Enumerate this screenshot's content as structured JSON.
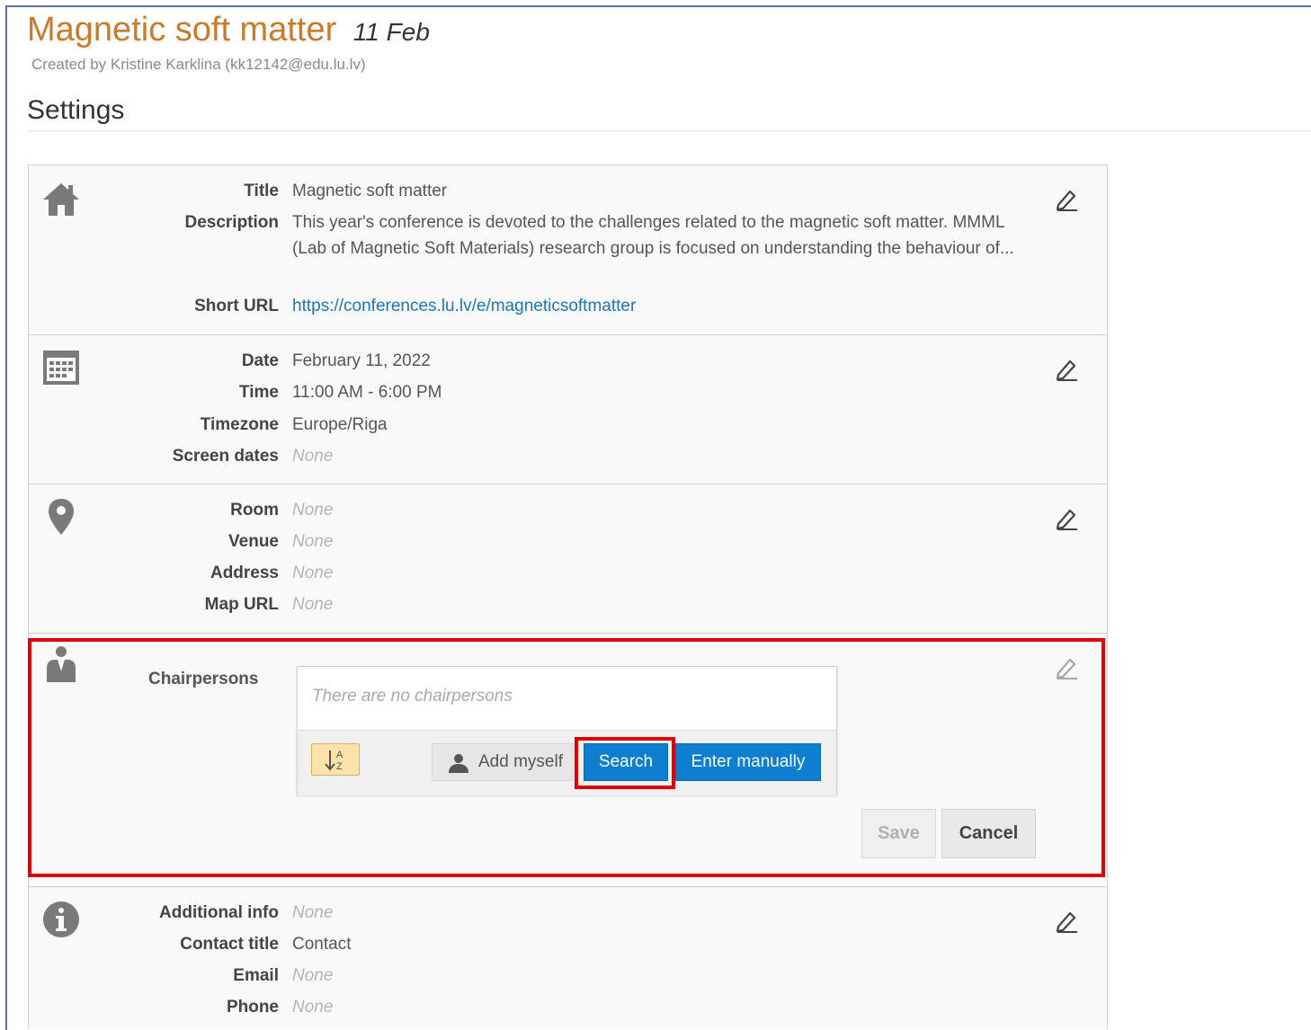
{
  "header": {
    "event_title": "Magnetic soft matter",
    "event_date": "11 Feb",
    "created_by": "Created by Kristine Karklina (kk12142@edu.lu.lv)",
    "settings_heading": "Settings"
  },
  "general": {
    "icon": "home-icon",
    "title_label": "Title",
    "title_value": "Magnetic soft matter",
    "description_label": "Description",
    "description_value": "This year's conference is devoted to the challenges related to the magnetic soft matter. MMML (Lab of Magnetic Soft Materials) research group is focused on understanding the behaviour of...",
    "short_url_label": "Short URL",
    "short_url_value": "https://conferences.lu.lv/e/magneticsoftmatter"
  },
  "datetime": {
    "icon": "calendar-icon",
    "date_label": "Date",
    "date_value": "February 11, 2022",
    "time_label": "Time",
    "time_value": "11:00 AM - 6:00 PM",
    "timezone_label": "Timezone",
    "timezone_value": "Europe/Riga",
    "screen_dates_label": "Screen dates",
    "screen_dates_value": "None"
  },
  "location": {
    "icon": "map-pin-icon",
    "room_label": "Room",
    "room_value": "None",
    "venue_label": "Venue",
    "venue_value": "None",
    "address_label": "Address",
    "address_value": "None",
    "map_url_label": "Map URL",
    "map_url_value": "None"
  },
  "chairpersons": {
    "icon": "person-icon",
    "label": "Chairpersons",
    "empty_text": "There are no chairpersons",
    "add_myself": "Add myself",
    "search": "Search",
    "enter_manually": "Enter manually",
    "save": "Save",
    "cancel": "Cancel"
  },
  "contact": {
    "icon": "info-icon",
    "additional_info_label": "Additional info",
    "additional_info_value": "None",
    "contact_title_label": "Contact title",
    "contact_title_value": "Contact",
    "email_label": "Email",
    "email_value": "None",
    "phone_label": "Phone",
    "phone_value": "None"
  },
  "colors": {
    "title_orange": "#cc7a2a",
    "primary_blue": "#0e7fd0",
    "highlight_red": "#e00000",
    "link_blue": "#1a76c0"
  }
}
